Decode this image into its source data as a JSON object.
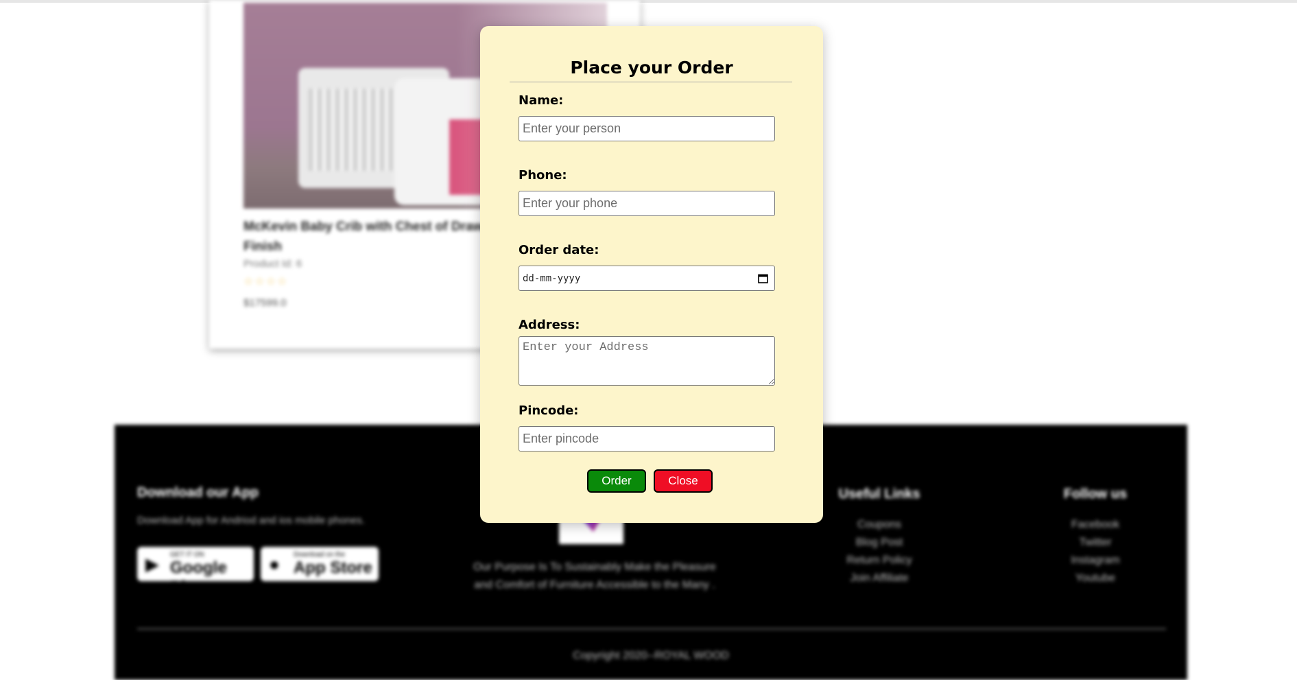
{
  "product": {
    "title": "McKevin Baby Crib with Chest of Drawers in White & Pink Finish",
    "id_text": "Product Id: 6",
    "rating_stars": "☆☆☆☆",
    "price": "$17599.0"
  },
  "footer": {
    "app_title": "Download our App",
    "app_text": "Download App for Andriod and ios mobile phones.",
    "google_badge_small": "GET IT ON",
    "google_badge_big": "Google Play",
    "apple_badge_small": "Download on the",
    "apple_badge_big": "App Store",
    "purpose_line1": "Our Purpose Is To Sustainably Make the Pleasure",
    "purpose_line2": "and Comfort of Furniture Accessible to the Many .",
    "useful_links_title": "Useful Links",
    "useful_links": [
      "Coupons",
      "Blog Post",
      "Return Policy",
      "Join Affiliate"
    ],
    "follow_title": "Follow us",
    "follow_links": [
      "Facebook",
      "Twitter",
      "Instagram",
      "Youtube"
    ],
    "copyright": "Copyright 2020--ROYAL WOOD"
  },
  "modal": {
    "title": "Place your Order",
    "name_label": "Name:",
    "name_placeholder": "Enter your person",
    "phone_label": "Phone:",
    "phone_placeholder": "Enter your phone",
    "date_label": "Order date:",
    "date_placeholder": "dd-mm-yyyy",
    "address_label": "Address:",
    "address_placeholder": "Enter your Address",
    "pincode_label": "Pincode:",
    "pincode_placeholder": "Enter pincode",
    "order_button": "Order",
    "close_button": "Close"
  },
  "colors": {
    "modal_bg": "#fdf5cb",
    "order_button": "#0a8a0a",
    "close_button": "#ef0e25",
    "footer_bg": "#000000"
  }
}
